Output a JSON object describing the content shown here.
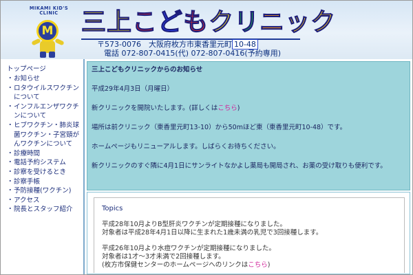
{
  "header": {
    "logo_arc_text": "MIKAMI KID'S CLINIC",
    "logo_letter": "M",
    "title_chars": [
      "三",
      "上",
      "こ",
      "ど",
      "も",
      "ク",
      "リ",
      "ニ",
      "ッ",
      "ク"
    ],
    "address_prefix": "〒573-0076　大阪府枚方市東香里元町",
    "address_number": "10-48",
    "tel": "電話 072-807-0415(代) 072-807-0416(予約専用)"
  },
  "sidebar": {
    "top_link": "トップページ",
    "bullet": "・",
    "items": [
      {
        "label": "お知らせ"
      },
      {
        "label": "ロタウイルスワクチンについて"
      },
      {
        "label": "インフルエンザワクチンについて"
      },
      {
        "label": "ヒブワクチン・肺炎球菌ワクチン・子宮頸がんワクチンについて"
      },
      {
        "label": "診療時間"
      },
      {
        "label": "電話予約システム"
      },
      {
        "label": "診察を受けるとき"
      },
      {
        "label": "診察手帳"
      },
      {
        "label": "予防接種(ワクチン)"
      },
      {
        "label": "アクセス"
      },
      {
        "label": "院長とスタッフ紹介"
      }
    ]
  },
  "notice": {
    "heading": "三上こどもクリニックからのお知らせ",
    "date": "平成29年4月3日（月曜日）",
    "line1_prefix": "新クリニックを開院いたします。(詳しくは",
    "line1_link": "こちら",
    "line1_suffix": ")",
    "line2": "場所は前クリニック（東香里元町13-10）から50mほど東（東香里元町10-48）です。",
    "line3": "ホームページもリニューアルします。しばらくお待ちください。",
    "line4": "新クリニックのすぐ隣に4月1日にサンライトなかよし薬局も開局され、お薬の受け取りも便利です。"
  },
  "topics": {
    "title": "Topics",
    "item1_a": "平成28年10月よりB型肝炎ワクチンが定期接種になりました。",
    "item1_b": "対象者は平成28年4月1日以降に生まれた1歳未満の乳児で3回接種します。",
    "item2_a": "平成26年10月より水痘ワクチンが定期接種になりました。",
    "item2_b": "対象者は1才〜3才未満で2回接種します。",
    "item2_c_prefix": "(枚方市保健センターのホームページへのリンクは",
    "item2_c_link": "こちら",
    "item2_c_suffix": ")"
  },
  "colors": {
    "header_bg": "#dde9f4",
    "sidebar_text": "#1a2c7a",
    "notice_bg": "#9ed5dc",
    "link": "#d1239a"
  }
}
